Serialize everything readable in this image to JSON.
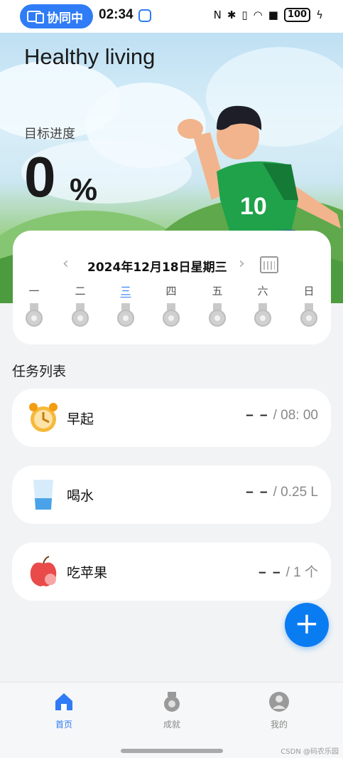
{
  "status_bar": {
    "collab_label": "协同中",
    "time": "02:34",
    "battery": "100"
  },
  "hero": {
    "app_title": "Healthy living",
    "goal_label": "目标进度",
    "goal_value": "0",
    "goal_unit": "%"
  },
  "calendar": {
    "prev": "‹",
    "date": "2024年12月18日星期三",
    "next": "›",
    "days": [
      "一",
      "二",
      "三",
      "四",
      "五",
      "六",
      "日"
    ],
    "active_day": 2
  },
  "tasks": {
    "title": "任务列表",
    "items": [
      {
        "name": "早起",
        "done": "– –",
        "target": "/ 08: 00"
      },
      {
        "name": "喝水",
        "done": "– –",
        "target": "/ 0.25 L"
      },
      {
        "name": "吃苹果",
        "done": "– –",
        "target": "/ 1 个"
      }
    ]
  },
  "fab_label": "+",
  "nav": {
    "items": [
      {
        "label": "首页"
      },
      {
        "label": "成就"
      },
      {
        "label": "我的"
      }
    ]
  },
  "watermark": "CSDN @码农乐园",
  "colors": {
    "accent": "#0a7cf2",
    "brand_pill": "#2f7cf6"
  }
}
